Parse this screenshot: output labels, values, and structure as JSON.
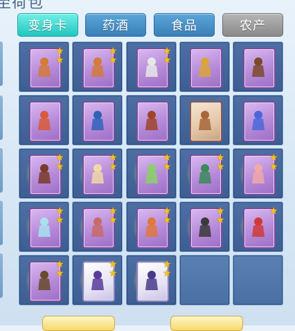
{
  "header": {
    "title_fragment": "至荷包"
  },
  "tabs": [
    {
      "label": "变身卡",
      "state": "active"
    },
    {
      "label": "药酒",
      "state": "normal"
    },
    {
      "label": "食品",
      "state": "normal"
    },
    {
      "label": "农产",
      "state": "disabled"
    }
  ],
  "colors": {
    "active_tab": "#23c5c0",
    "normal_tab": "#3b7fb8",
    "disabled_tab": "#8a8a8a",
    "slot_bg": "#3d5e93",
    "card_purple": "#b68ad8",
    "star": "#f5c21b"
  },
  "inventory": {
    "rows": [
      [
        {
          "item": "card",
          "icon": "monkey-warrior-card-icon",
          "stars": 2,
          "glow": false,
          "style": "purple",
          "figure": "#d27a3a"
        },
        {
          "item": "card",
          "icon": "monkey-warrior-card-icon",
          "stars": 2,
          "glow": false,
          "style": "purple",
          "figure": "#d57a3a"
        },
        {
          "item": "card",
          "icon": "cow-demon-card-icon",
          "stars": 2,
          "glow": false,
          "style": "purple",
          "figure": "#e7e7e7"
        },
        {
          "item": "card",
          "icon": "golden-warrior-card-icon",
          "stars": 0,
          "glow": false,
          "style": "purple",
          "figure": "#d9a43a"
        },
        {
          "item": "card",
          "icon": "monk-warrior-card-icon",
          "stars": 0,
          "glow": false,
          "style": "purple",
          "figure": "#7a4a2a"
        }
      ],
      [
        {
          "item": "card",
          "icon": "red-warrior-card-icon",
          "stars": 0,
          "glow": false,
          "style": "purple",
          "figure": "#d85a3a"
        },
        {
          "item": "card",
          "icon": "panda-card-icon",
          "stars": 0,
          "glow": false,
          "style": "purple",
          "figure": "#2f63b8"
        },
        {
          "item": "card",
          "icon": "demon-warrior-card-icon",
          "stars": 0,
          "glow": false,
          "style": "purple",
          "figure": "#a04428"
        },
        {
          "item": "card",
          "icon": "strongman-card-icon",
          "stars": 0,
          "glow": false,
          "style": "tan",
          "figure": "#a8663a"
        },
        {
          "item": "card",
          "icon": "blue-imp-card-icon",
          "stars": 0,
          "glow": false,
          "style": "purple",
          "figure": "#4a68d8"
        }
      ],
      [
        {
          "item": "card",
          "icon": "brown-warrior-card-icon",
          "stars": 2,
          "glow": true,
          "style": "purple",
          "figure": "#7a3a2a"
        },
        {
          "item": "card",
          "icon": "white-hair-warrior-card-icon",
          "stars": 2,
          "glow": true,
          "style": "purple",
          "figure": "#f0d8a8"
        },
        {
          "item": "card",
          "icon": "green-dancer-card-icon",
          "stars": 2,
          "glow": true,
          "style": "purple",
          "figure": "#8bd06a"
        },
        {
          "item": "card",
          "icon": "jade-warrior-card-icon",
          "stars": 2,
          "glow": true,
          "style": "purple",
          "figure": "#3a8a5a"
        },
        {
          "item": "card",
          "icon": "rabbit-girl-card-icon",
          "stars": 2,
          "glow": true,
          "style": "purple",
          "figure": "#f0a8a8"
        }
      ],
      [
        {
          "item": "card",
          "icon": "ice-fairy-card-icon",
          "stars": 2,
          "glow": true,
          "style": "purple",
          "figure": "#a8e0f0"
        },
        {
          "item": "card",
          "icon": "pink-warrior-card-icon",
          "stars": 2,
          "glow": true,
          "style": "purple",
          "figure": "#c86a6a"
        },
        {
          "item": "card",
          "icon": "flame-warrior-card-icon",
          "stars": 2,
          "glow": true,
          "style": "purple",
          "figure": "#e0783a"
        },
        {
          "item": "card",
          "icon": "dark-warrior-card-icon",
          "stars": 2,
          "glow": true,
          "style": "purple",
          "figure": "#3a3a3a"
        },
        {
          "item": "card",
          "icon": "dragon-card-icon",
          "stars": 1,
          "glow": true,
          "style": "purple",
          "figure": "#d03a3a"
        }
      ],
      [
        {
          "item": "card",
          "icon": "bronze-warrior-card-icon",
          "stars": 2,
          "glow": true,
          "style": "purple",
          "figure": "#6a4a2a"
        },
        {
          "item": "card",
          "icon": "violet-knight-card-icon",
          "stars": 2,
          "glow": true,
          "style": "white",
          "figure": "#5a3a9a"
        },
        {
          "item": "card",
          "icon": "violet-mage-card-icon",
          "stars": 2,
          "glow": true,
          "style": "white",
          "figure": "#4a3a8a"
        },
        {
          "item": "empty"
        },
        {
          "item": "empty"
        }
      ]
    ]
  },
  "bottom_buttons": [
    "left",
    "right"
  ]
}
